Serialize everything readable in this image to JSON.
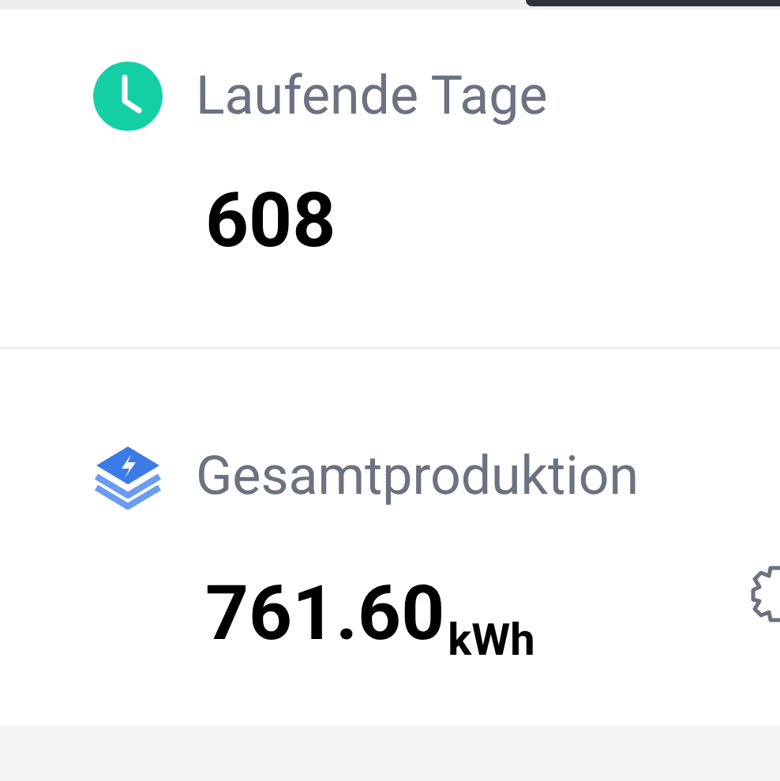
{
  "stats": [
    {
      "kind": "clock",
      "label": "Laufende Tage",
      "value": "608"
    },
    {
      "kind": "layers",
      "label": "Gesamtproduktion",
      "value": "761.60",
      "unit": "kWh"
    }
  ]
}
